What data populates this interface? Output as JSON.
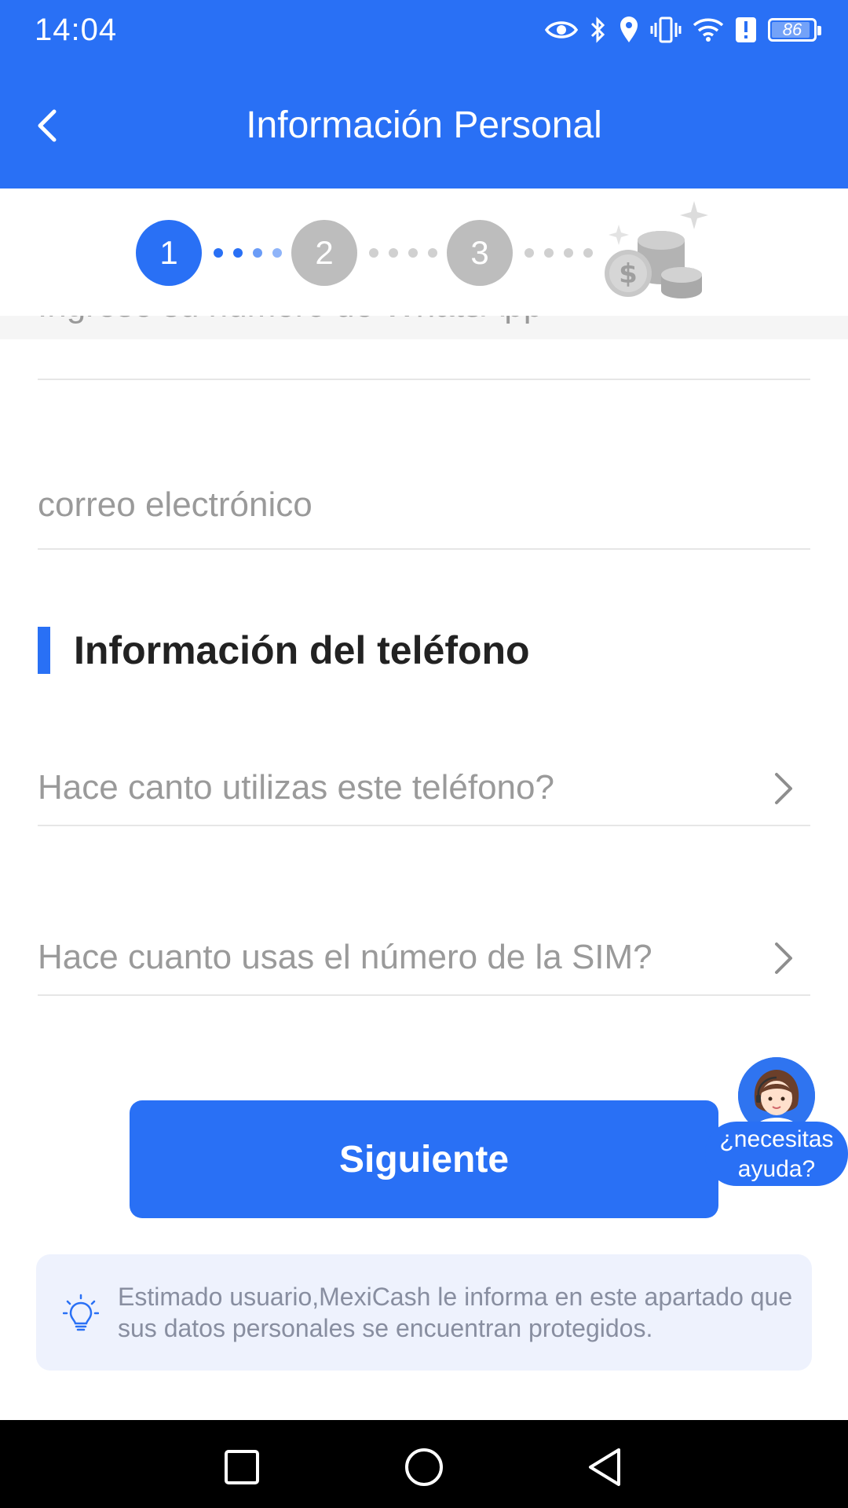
{
  "status_bar": {
    "time": "14:04",
    "battery_level": "86",
    "icons": [
      "eye-icon",
      "bluetooth-icon",
      "location-icon",
      "vibrate-icon",
      "wifi-icon",
      "alert-icon",
      "battery-icon"
    ]
  },
  "app_bar": {
    "title": "Información Personal",
    "back_icon": "chevron-left-icon"
  },
  "stepper": {
    "steps": [
      "1",
      "2",
      "3"
    ],
    "current_step": 1,
    "active_color": "#2970f5",
    "inactive_color": "#bdbdbd",
    "final_icon": "coins-icon"
  },
  "form": {
    "whatsapp_placeholder": "Ingrese su número de WhatsApp",
    "email_placeholder": "correo electrónico",
    "phone_section_title": "Información del teléfono",
    "phone_usage_placeholder": "Hace canto utilizas este teléfono?",
    "sim_usage_placeholder": "Hace cuanto usas el número de la SIM?"
  },
  "actions": {
    "next_label": "Siguiente"
  },
  "help": {
    "line1": "¿necesitas",
    "line2": "ayuda?"
  },
  "notice": {
    "text": "Estimado usuario,MexiCash le informa en este apartado que sus datos personales se encuentran protegidos.",
    "icon": "lightbulb-icon"
  },
  "colors": {
    "brand": "#2970f5",
    "notice_bg": "#eef2fd"
  }
}
